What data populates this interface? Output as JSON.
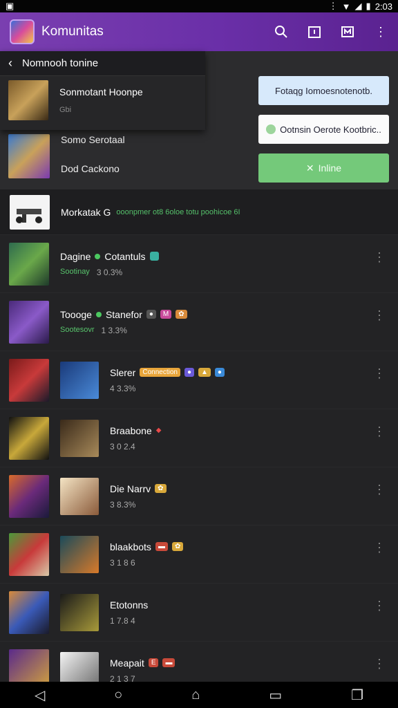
{
  "status": {
    "time": "2:03"
  },
  "appbar": {
    "title": "Komunitas",
    "icons": [
      "search-icon",
      "calendar-icon",
      "tag-icon",
      "more-vert-icon"
    ]
  },
  "dropdown": {
    "header": "Nomnooh tonine",
    "row": {
      "main": "Sonmotant Hoonpe",
      "sub": "Gbi"
    }
  },
  "under_row": {
    "line1": "Somo Serotaal",
    "line2": "Dod Cackono"
  },
  "buttons": {
    "blue": "Fotaqg  Iomoesnotenotb.",
    "white": "Ootnsin Oerote Kootbric..",
    "green": "Inline"
  },
  "highlight": {
    "name": "Morkatak G",
    "note": "ooonpmer ot8 6oloe totu poohicoe 6I"
  },
  "items": [
    {
      "title": "Dagine",
      "title2": "Cotantuls",
      "sub_green": "Sootinay",
      "sub": "3 0.3%"
    },
    {
      "title": "Toooge",
      "title2": "Stanefor",
      "sub_green": "Sootesovr",
      "sub": "1 3.3%"
    },
    {
      "title": "Slerer",
      "badge": "Connection",
      "sub": "4 3.3%"
    },
    {
      "title": "Braabone",
      "sub": "3 0 2.4"
    },
    {
      "title": "Die Narrv",
      "sub": "3 8.3%"
    },
    {
      "title": "blaakbots",
      "sub": "3 1 8 6"
    },
    {
      "title": "Etotonns",
      "sub": "1 7.8 4"
    },
    {
      "title": "Meapait",
      "sub": "2 1 3 7"
    }
  ],
  "colors": {
    "appbar": "#6a2fa8",
    "accent_green": "#74c97a",
    "button_blue": "#d7e9fb"
  }
}
